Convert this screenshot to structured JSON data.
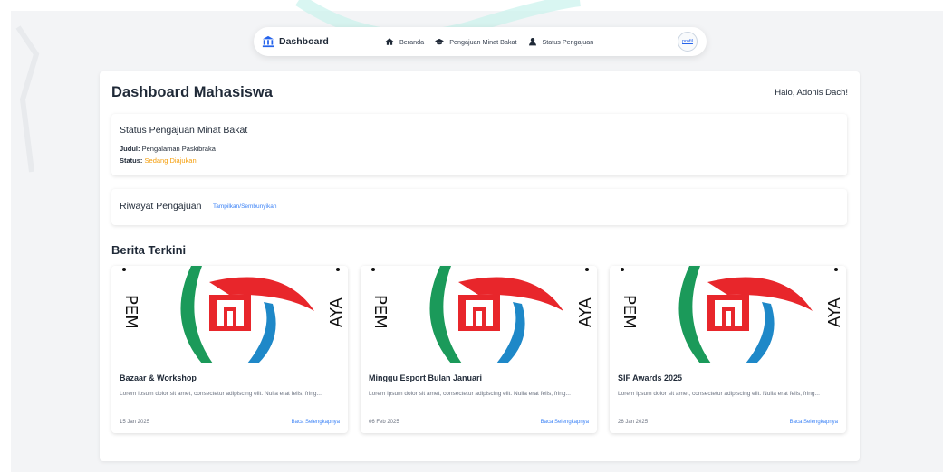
{
  "navbar": {
    "brand": "Dashboard",
    "links": [
      {
        "label": "Beranda",
        "icon": "home-icon"
      },
      {
        "label": "Pengajuan Minat Bakat",
        "icon": "graduation-cap-icon"
      },
      {
        "label": "Status Pengajuan",
        "icon": "user-icon"
      }
    ],
    "avatar_alt": "profil"
  },
  "page": {
    "title": "Dashboard Mahasiswa",
    "greeting": "Halo, Adonis Dach!"
  },
  "status_panel": {
    "title": "Status Pengajuan Minat Bakat",
    "judul_label": "Judul:",
    "judul_value": "Pengalaman Paskibraka",
    "status_label": "Status:",
    "status_value": "Sedang Diajukan"
  },
  "history_panel": {
    "title": "Riwayat Pengajuan",
    "toggle": "Tampilkan/Sembunyikan"
  },
  "news": {
    "title": "Berita Terkini",
    "items": [
      {
        "title": "Bazaar & Workshop",
        "excerpt": "Lorem ipsum dolor sit amet, consectetur adipiscing elit. Nulla erat felis, fring...",
        "date": "15 Jan 2025",
        "link": "Baca Selengkapnya"
      },
      {
        "title": "Minggu Esport Bulan Januari",
        "excerpt": "Lorem ipsum dolor sit amet, consectetur adipiscing elit. Nulla erat felis, fring...",
        "date": "06 Feb 2025",
        "link": "Baca Selengkapnya"
      },
      {
        "title": "SIF Awards 2025",
        "excerpt": "Lorem ipsum dolor sit amet, consectetur adipiscing elit. Nulla erat felis, fring...",
        "date": "26 Jan 2025",
        "link": "Baca Selengkapnya"
      }
    ],
    "image_ring_text": {
      "left": "PEM",
      "right": "AYA"
    }
  },
  "colors": {
    "background": "#f3f4f6",
    "status_pending": "#f59e0b",
    "link": "#3b82f6",
    "logo_red": "#e8262b",
    "logo_green": "#1b9a5a",
    "logo_blue": "#1e88c8"
  }
}
